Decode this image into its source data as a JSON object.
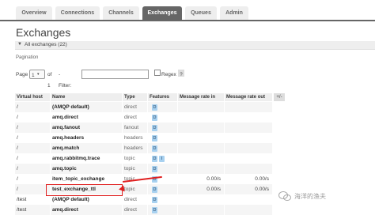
{
  "nav": {
    "tabs": [
      "Overview",
      "Connections",
      "Channels",
      "Exchanges",
      "Queues",
      "Admin"
    ],
    "active": "Exchanges"
  },
  "page": {
    "title": "Exchanges",
    "section": "All exchanges (22)",
    "pagination_label": "Pagination",
    "page_label": "Page",
    "page_value": "1",
    "of_label": "of 1",
    "filter_label": "- Filter:",
    "filter_value": "",
    "regex_label": "Regex",
    "help": "?"
  },
  "table": {
    "headers": [
      "Virtual host",
      "Name",
      "Type",
      "Features",
      "Message rate in",
      "Message rate out"
    ],
    "plusminus": "+/-",
    "rows": [
      {
        "vhost": "/",
        "name": "(AMQP default)",
        "type": "direct",
        "features": [
          "D"
        ],
        "rate_in": "",
        "rate_out": ""
      },
      {
        "vhost": "/",
        "name": "amq.direct",
        "type": "direct",
        "features": [
          "D"
        ],
        "rate_in": "",
        "rate_out": ""
      },
      {
        "vhost": "/",
        "name": "amq.fanout",
        "type": "fanout",
        "features": [
          "D"
        ],
        "rate_in": "",
        "rate_out": ""
      },
      {
        "vhost": "/",
        "name": "amq.headers",
        "type": "headers",
        "features": [
          "D"
        ],
        "rate_in": "",
        "rate_out": ""
      },
      {
        "vhost": "/",
        "name": "amq.match",
        "type": "headers",
        "features": [
          "D"
        ],
        "rate_in": "",
        "rate_out": ""
      },
      {
        "vhost": "/",
        "name": "amq.rabbitmq.trace",
        "type": "topic",
        "features": [
          "D",
          "I"
        ],
        "rate_in": "",
        "rate_out": ""
      },
      {
        "vhost": "/",
        "name": "amq.topic",
        "type": "topic",
        "features": [
          "D"
        ],
        "rate_in": "",
        "rate_out": ""
      },
      {
        "vhost": "/",
        "name": "item_topic_exchange",
        "type": "topic",
        "features": [
          "D"
        ],
        "rate_in": "0.00/s",
        "rate_out": "0.00/s"
      },
      {
        "vhost": "/",
        "name": "test_exchange_ttl",
        "type": "topic",
        "features": [
          "D"
        ],
        "rate_in": "0.00/s",
        "rate_out": "0.00/s"
      },
      {
        "vhost": "/test",
        "name": "(AMQP default)",
        "type": "direct",
        "features": [
          "D"
        ],
        "rate_in": "",
        "rate_out": ""
      },
      {
        "vhost": "/test",
        "name": "amq.direct",
        "type": "direct",
        "features": [
          "D"
        ],
        "rate_in": "",
        "rate_out": ""
      }
    ]
  },
  "watermark": "海洋的渔夫",
  "colors": {
    "accent": "#666666",
    "feature_badge": "#a8d1f0",
    "highlight": "#e02020"
  }
}
